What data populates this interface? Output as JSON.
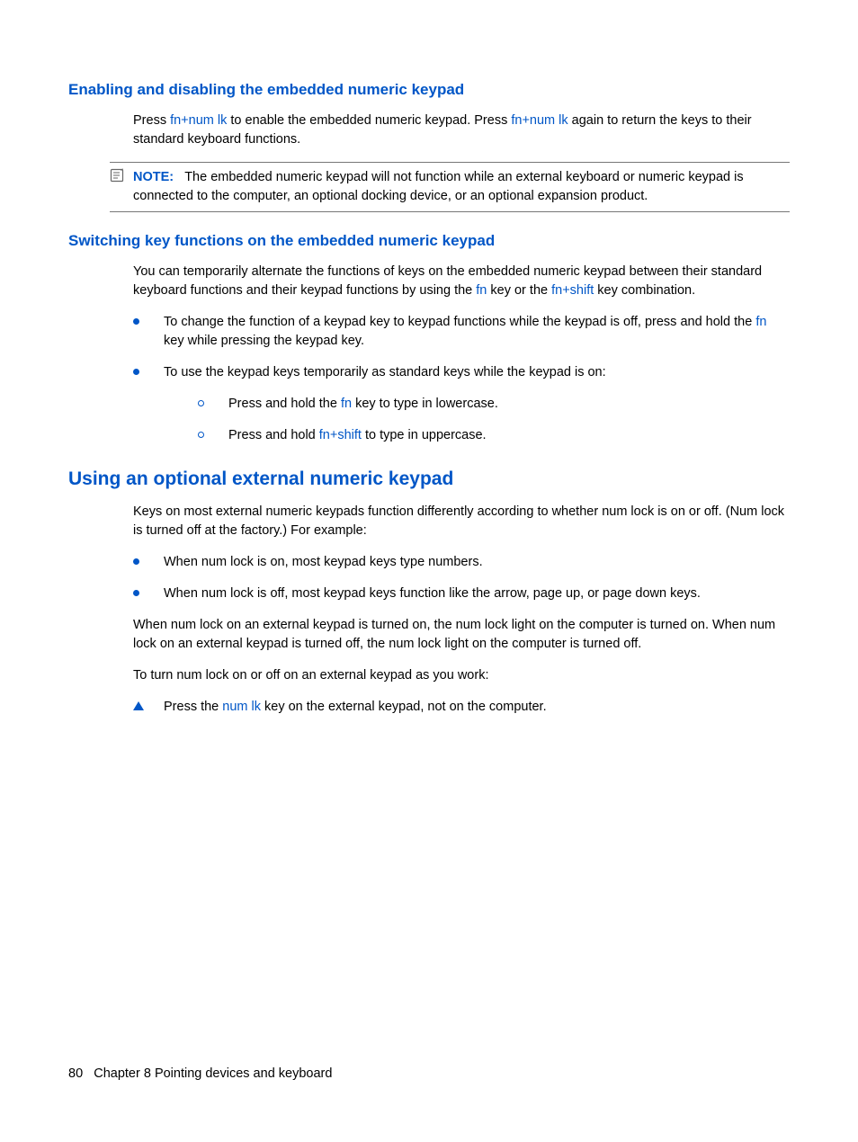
{
  "section1": {
    "heading": "Enabling and disabling the embedded numeric keypad",
    "p1a": "Press ",
    "p1k1": "fn+num lk",
    "p1b": " to enable the embedded numeric keypad. Press ",
    "p1k2": "fn+num lk",
    "p1c": " again to return the keys to their standard keyboard functions."
  },
  "note": {
    "label": "NOTE:",
    "text": "The embedded numeric keypad will not function while an external keyboard or numeric keypad is connected to the computer, an optional docking device, or an optional expansion product."
  },
  "section2": {
    "heading": "Switching key functions on the embedded numeric keypad",
    "p1a": "You can temporarily alternate the functions of keys on the embedded numeric keypad between their standard keyboard functions and their keypad functions by using the ",
    "p1k1": "fn",
    "p1b": " key or the ",
    "p1k2": "fn+shift",
    "p1c": " key combination.",
    "b1a": "To change the function of a keypad key to keypad functions while the keypad is off, press and hold the ",
    "b1k": "fn",
    "b1b": " key while pressing the keypad key.",
    "b2": "To use the keypad keys temporarily as standard keys while the keypad is on:",
    "sb1a": "Press and hold the ",
    "sb1k": "fn",
    "sb1b": " key to type in lowercase.",
    "sb2a": "Press and hold ",
    "sb2k": "fn+shift",
    "sb2b": " to type in uppercase."
  },
  "section3": {
    "heading": "Using an optional external numeric keypad",
    "p1": "Keys on most external numeric keypads function differently according to whether num lock is on or off. (Num lock is turned off at the factory.) For example:",
    "b1": "When num lock is on, most keypad keys type numbers.",
    "b2": "When num lock is off, most keypad keys function like the arrow, page up, or page down keys.",
    "p2": "When num lock on an external keypad is turned on, the num lock light on the computer is turned on. When num lock on an external keypad is turned off, the num lock light on the computer is turned off.",
    "p3": "To turn num lock on or off on an external keypad as you work:",
    "t1a": "Press the ",
    "t1k": "num lk",
    "t1b": " key on the external keypad, not on the computer."
  },
  "footer": {
    "pageNum": "80",
    "chapter": "Chapter 8   Pointing devices and keyboard"
  }
}
